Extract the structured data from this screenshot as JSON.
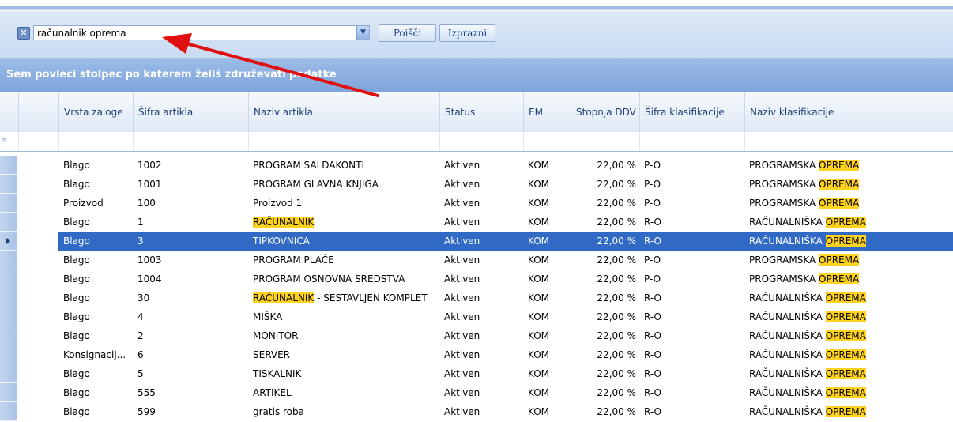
{
  "findbar": {
    "search_value": "računalnik oprema",
    "find_label": "Poišči",
    "clear_label": "Izprazni"
  },
  "grouping": {
    "hint": "Sem povleci stolpec po katerem želiš združevati podatke"
  },
  "columns": [
    "Vrsta zaloge",
    "Šifra artikla",
    "Naziv artikla",
    "Status",
    "EM",
    "Stopnja DDV",
    "Šifra klasifikacije",
    "Naziv klasifikacije"
  ],
  "rows": [
    {
      "vrsta": "Blago",
      "sifra": "1002",
      "naziv": "PROGRAM SALDAKONTI",
      "status": "Aktiven",
      "em": "KOM",
      "ddv": "22,00 %",
      "klas": "P-O",
      "naziv_klas": "PROGRAMSKA OPREMA"
    },
    {
      "vrsta": "Blago",
      "sifra": "1001",
      "naziv": "PROGRAM GLAVNA KNJIGA",
      "status": "Aktiven",
      "em": "KOM",
      "ddv": "22,00 %",
      "klas": "P-O",
      "naziv_klas": "PROGRAMSKA OPREMA"
    },
    {
      "vrsta": "Proizvod",
      "sifra": "100",
      "naziv": "Proizvod 1",
      "status": "Aktiven",
      "em": "KOM",
      "ddv": "22,00 %",
      "klas": "P-O",
      "naziv_klas": "PROGRAMSKA OPREMA"
    },
    {
      "vrsta": "Blago",
      "sifra": "1",
      "naziv": "RAČUNALNIK",
      "status": "Aktiven",
      "em": "KOM",
      "ddv": "22,00 %",
      "klas": "R-O",
      "naziv_klas": "RAČUNALNIŠKA OPREMA"
    },
    {
      "vrsta": "Blago",
      "sifra": "3",
      "naziv": "TIPKOVNICA",
      "status": "Aktiven",
      "em": "KOM",
      "ddv": "22,00 %",
      "klas": "R-O",
      "naziv_klas": "RAČUNALNIŠKA OPREMA"
    },
    {
      "vrsta": "Blago",
      "sifra": "1003",
      "naziv": "PROGRAM PLAČE",
      "status": "Aktiven",
      "em": "KOM",
      "ddv": "22,00 %",
      "klas": "P-O",
      "naziv_klas": "PROGRAMSKA OPREMA"
    },
    {
      "vrsta": "Blago",
      "sifra": "1004",
      "naziv": "PROGRAM OSNOVNA SREDSTVA",
      "status": "Aktiven",
      "em": "KOM",
      "ddv": "22,00 %",
      "klas": "P-O",
      "naziv_klas": "PROGRAMSKA OPREMA"
    },
    {
      "vrsta": "Blago",
      "sifra": "30",
      "naziv": "RAČUNALNIK - SESTAVLJEN KOMPLET",
      "status": "Aktiven",
      "em": "KOM",
      "ddv": "22,00 %",
      "klas": "R-O",
      "naziv_klas": "RAČUNALNIŠKA OPREMA"
    },
    {
      "vrsta": "Blago",
      "sifra": "4",
      "naziv": "MIŠKA",
      "status": "Aktiven",
      "em": "KOM",
      "ddv": "22,00 %",
      "klas": "R-O",
      "naziv_klas": "RAČUNALNIŠKA OPREMA"
    },
    {
      "vrsta": "Blago",
      "sifra": "2",
      "naziv": "MONITOR",
      "status": "Aktiven",
      "em": "KOM",
      "ddv": "22,00 %",
      "klas": "R-O",
      "naziv_klas": "RAČUNALNIŠKA OPREMA"
    },
    {
      "vrsta": "Konsignacij...",
      "sifra": "6",
      "naziv": "SERVER",
      "status": "Aktiven",
      "em": "KOM",
      "ddv": "22,00 %",
      "klas": "R-O",
      "naziv_klas": "RAČUNALNIŠKA OPREMA"
    },
    {
      "vrsta": "Blago",
      "sifra": "5",
      "naziv": "TISKALNIK",
      "status": "Aktiven",
      "em": "KOM",
      "ddv": "22,00 %",
      "klas": "R-O",
      "naziv_klas": "RAČUNALNIŠKA OPREMA"
    },
    {
      "vrsta": "Blago",
      "sifra": "555",
      "naziv": "ARTIKEL",
      "status": "Aktiven",
      "em": "KOM",
      "ddv": "22,00 %",
      "klas": "R-O",
      "naziv_klas": "RAČUNALNIŠKA OPREMA"
    },
    {
      "vrsta": "Blago",
      "sifra": "599",
      "naziv": "gratis roba",
      "status": "Aktiven",
      "em": "KOM",
      "ddv": "22,00 %",
      "klas": "R-O",
      "naziv_klas": "RAČUNALNIŠKA OPREMA"
    }
  ],
  "selected_row": 4,
  "highlight_terms": [
    "RAČUNALNIK",
    "OPREMA"
  ],
  "colors": {
    "selection": "#316ac5",
    "highlight": "#ffd21f",
    "arrow": "#e01010"
  }
}
